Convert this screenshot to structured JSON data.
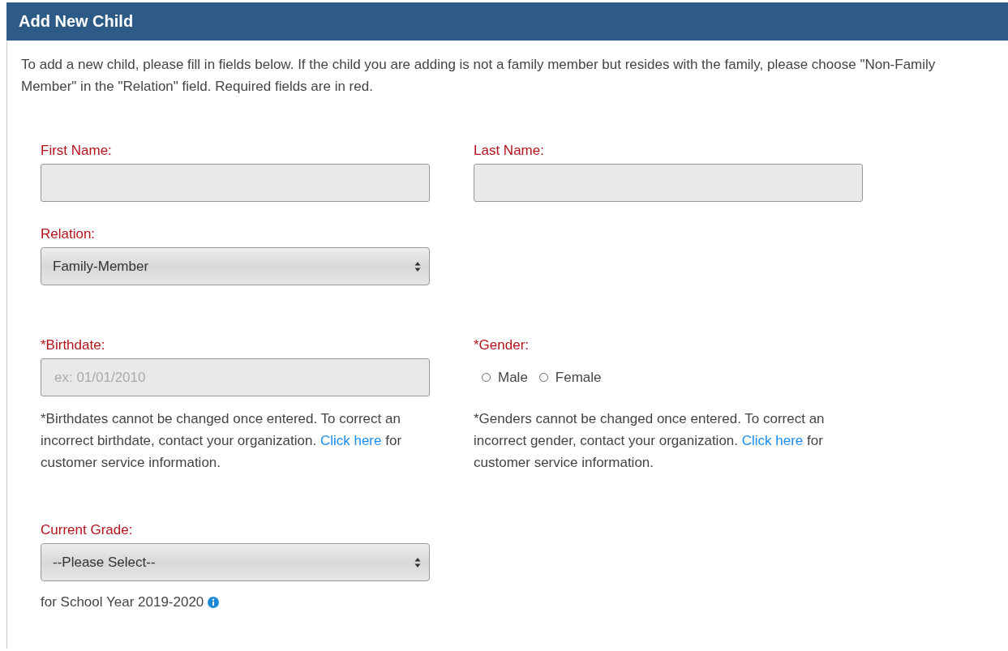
{
  "panel": {
    "title": "Add New Child"
  },
  "intro": "To add a new child, please fill in fields below. If the child you are adding is not a family member but resides with the family, please choose \"Non-Family Member\" in the \"Relation\" field. Required fields are in red.",
  "first_name": {
    "label": "First Name:",
    "required": true
  },
  "last_name": {
    "label": "Last Name:",
    "required": true
  },
  "relation": {
    "label": "Relation:",
    "required": true,
    "value": "Family-Member"
  },
  "birthdate": {
    "label": "*Birthdate:",
    "required": true,
    "placeholder": "ex: 01/01/2010",
    "note": {
      "before": "*Birthdates cannot be changed once entered. To correct an incorrect birthdate, contact your organization. ",
      "link": "Click here",
      "after": " for customer service information."
    }
  },
  "gender": {
    "label": "*Gender:",
    "required": true,
    "options": [
      {
        "label": "Male",
        "selected": false
      },
      {
        "label": "Female",
        "selected": false
      }
    ],
    "note": {
      "before": "*Genders cannot be changed once entered. To correct an incorrect gender, contact your organization. ",
      "link": "Click here",
      "after": " for customer service information."
    }
  },
  "current_grade": {
    "label": "Current Grade:",
    "required": true,
    "value": "--Please Select--",
    "note": "for School Year 2019-2020"
  }
}
